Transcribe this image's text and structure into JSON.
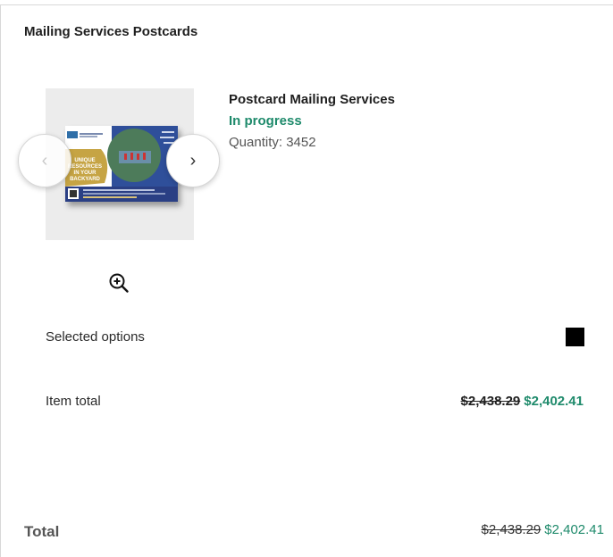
{
  "card": {
    "title": "Mailing Services Postcards"
  },
  "product": {
    "name": "Postcard Mailing Services",
    "status": "In progress",
    "quantity_text": "Quantity: 3452",
    "image": {
      "postcard_text": [
        "UNIQUE",
        "RESOURCES",
        "IN YOUR",
        "BACKYARD"
      ]
    }
  },
  "carousel": {
    "prev_icon": "chevron-left-icon",
    "next_icon": "chevron-right-icon",
    "prev_glyph": "‹",
    "next_glyph": "›"
  },
  "zoom": {
    "icon": "zoom-in-icon"
  },
  "selected_options": {
    "label": "Selected options"
  },
  "item_total": {
    "label": "Item total",
    "original": "$2,438.29",
    "discounted": "$2,402.41"
  },
  "order_total": {
    "label": "Total",
    "original": "$2,438.29",
    "discounted": "$2,402.41"
  },
  "colors": {
    "accent_green": "#1e8a6b",
    "thumb_bg": "#ececec",
    "border": "#d8d8d8"
  }
}
